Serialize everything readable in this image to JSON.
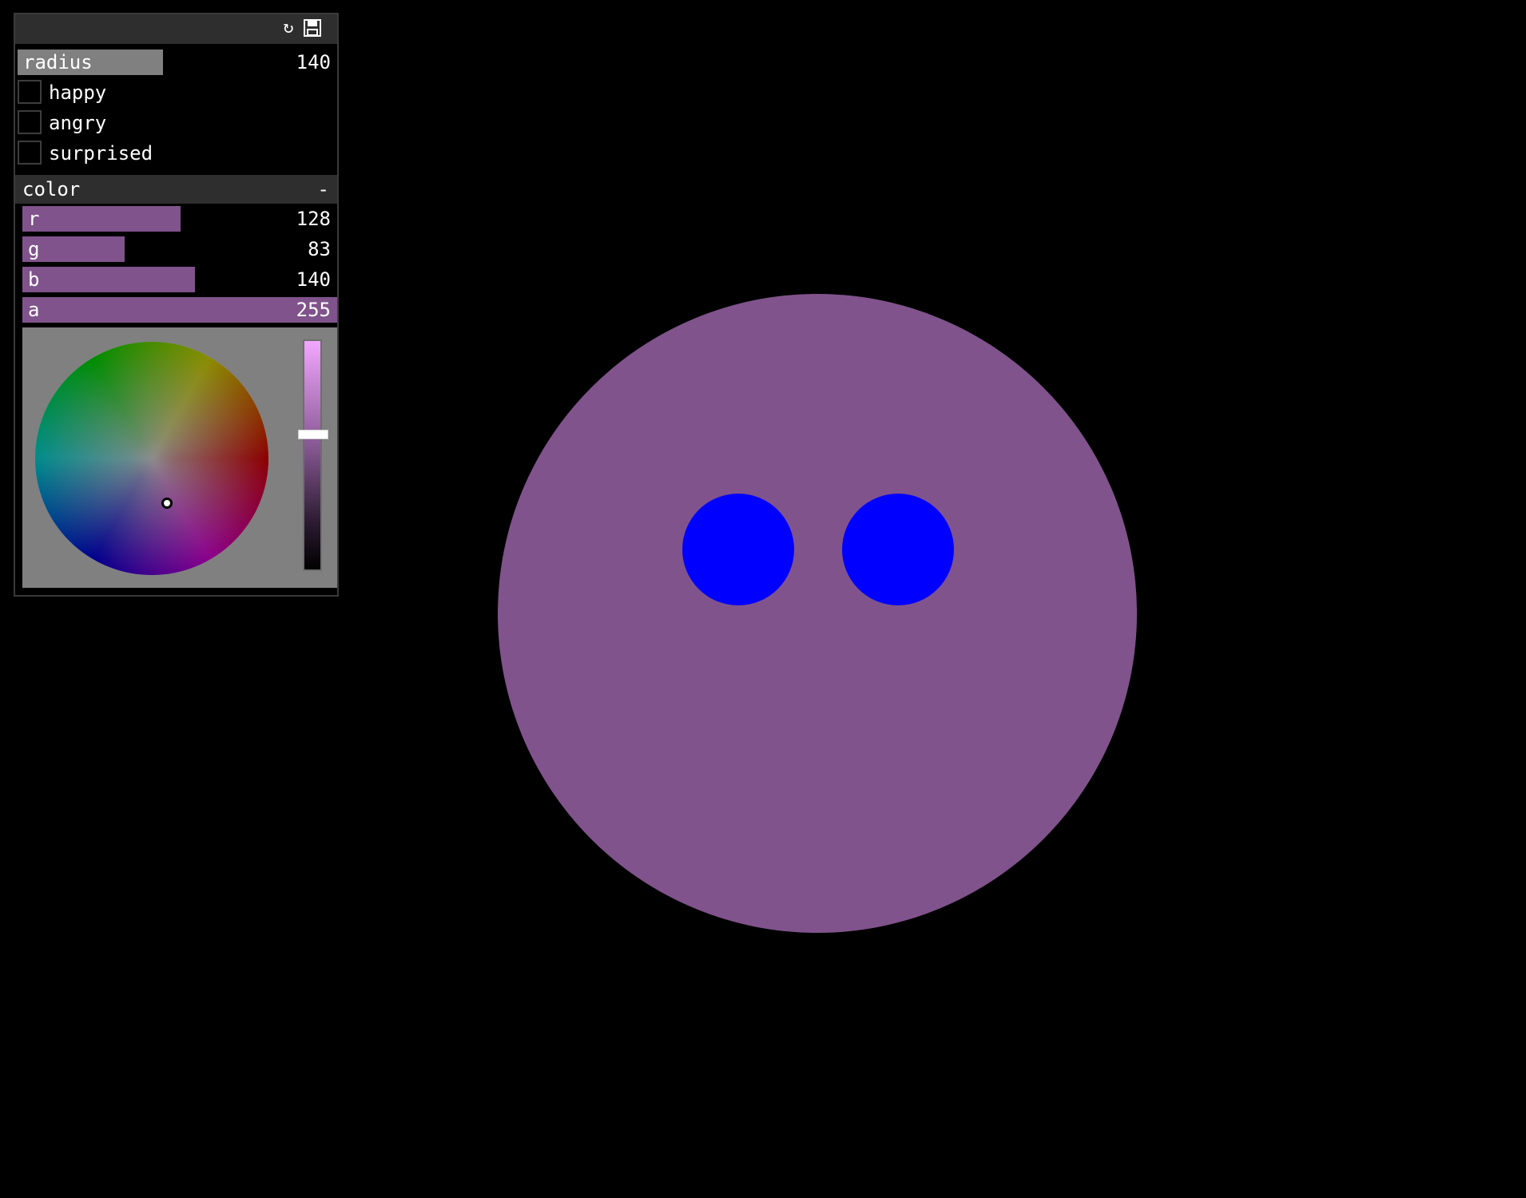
{
  "panel": {
    "header_icons": [
      "reload-icon",
      "save-icon"
    ],
    "radius": {
      "label": "radius",
      "value": "140",
      "fill_fraction": 0.455
    },
    "toggles": [
      {
        "label": "happy",
        "checked": false
      },
      {
        "label": "angry",
        "checked": false
      },
      {
        "label": "surprised",
        "checked": false
      }
    ],
    "color": {
      "label": "color",
      "minimize_symbol": "-",
      "channels": [
        {
          "label": "r",
          "value": "128",
          "fraction": 0.502
        },
        {
          "label": "g",
          "value": "83",
          "fraction": 0.325
        },
        {
          "label": "b",
          "value": "140",
          "fraction": 0.549
        },
        {
          "label": "a",
          "value": "255",
          "fraction": 1.0
        }
      ],
      "hex": "#80538c",
      "brightness_fraction": 0.55
    }
  },
  "scene": {
    "face_color": "#80538c",
    "eye_color": "#0000ff",
    "background": "#000000"
  },
  "colors": {
    "panel_bg": "#000000",
    "header_bg": "#2e2e2e",
    "radius_fill": "#808080",
    "channel_fill": "#80538c",
    "picker_bg": "#808080"
  }
}
